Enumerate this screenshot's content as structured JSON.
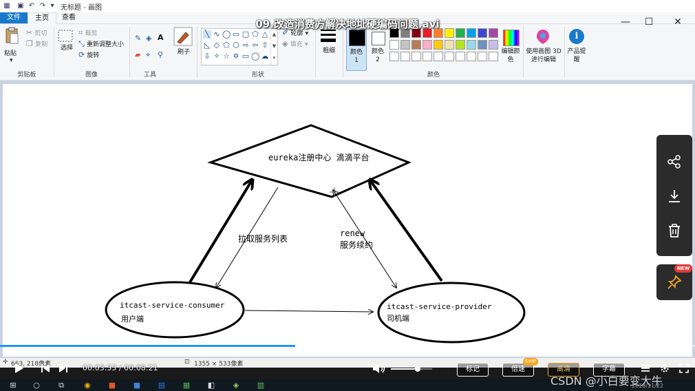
{
  "window": {
    "doc_title": "无标题 - 画图"
  },
  "tabs": {
    "file": "文件",
    "home": "主页",
    "view": "查看"
  },
  "ribbon": {
    "clipboard": {
      "paste": "粘贴",
      "cut": "剪切",
      "copy": "复制",
      "label": "剪贴板"
    },
    "image": {
      "select": "选择",
      "crop": "裁剪",
      "resize": "重新调整大小",
      "rotate": "旋转",
      "label": "图像"
    },
    "tools": {
      "label": "工具"
    },
    "brushes": {
      "label": "刷子"
    },
    "shapes": {
      "outline": "轮廓",
      "fill": "填充",
      "label": "形状"
    },
    "size": {
      "label": "粗细"
    },
    "colors": {
      "color1": "颜色 1",
      "color2": "颜色 2",
      "edit": "编辑颜色",
      "label": "颜色",
      "palette_row1": [
        "#000000",
        "#7f7f7f",
        "#880015",
        "#ed1c24",
        "#ff7f27",
        "#fff200",
        "#22b14c",
        "#00a2e8",
        "#3f48cc",
        "#a349a4"
      ],
      "palette_row2": [
        "#ffffff",
        "#c3c3c3",
        "#b97a57",
        "#ffaec9",
        "#ffc90e",
        "#efe4b0",
        "#b5e61d",
        "#99d9ea",
        "#7092be",
        "#c8bfe7"
      ],
      "color1_value": "#000000",
      "color2_value": "#ffffff"
    },
    "paint3d": {
      "label": "使用画图 3D 进行编辑"
    },
    "product": {
      "label": "产品提醒"
    }
  },
  "diagram": {
    "registry_label": "eureka注册中心  滴滴平台",
    "consumer_name": "itcast-service-consumer",
    "consumer_role": "用户端",
    "provider_name": "itcast-service-provider",
    "provider_role": "司机端",
    "pull_label": "拉取服务列表",
    "renew_label_1": "renew",
    "renew_label_2": "服务续约"
  },
  "video": {
    "title": "09.改造消费方解决地址硬编码问题.avi",
    "current_time": "00:03:33",
    "total_time": "00:08:21",
    "progress": 0.425,
    "volume": 0.65,
    "buttons": {
      "mark": "标记",
      "speed": "倍速",
      "hd": "高清",
      "subtitle": "字幕"
    },
    "svip": "SVIP",
    "new_badge": "NEW"
  },
  "statusbar": {
    "cursor": "663, 218像素",
    "canvas_size": "1355 × 533像素"
  },
  "overlay": {
    "watermark": "CSDN @小白要变大牛",
    "date": "2018/11/22"
  }
}
